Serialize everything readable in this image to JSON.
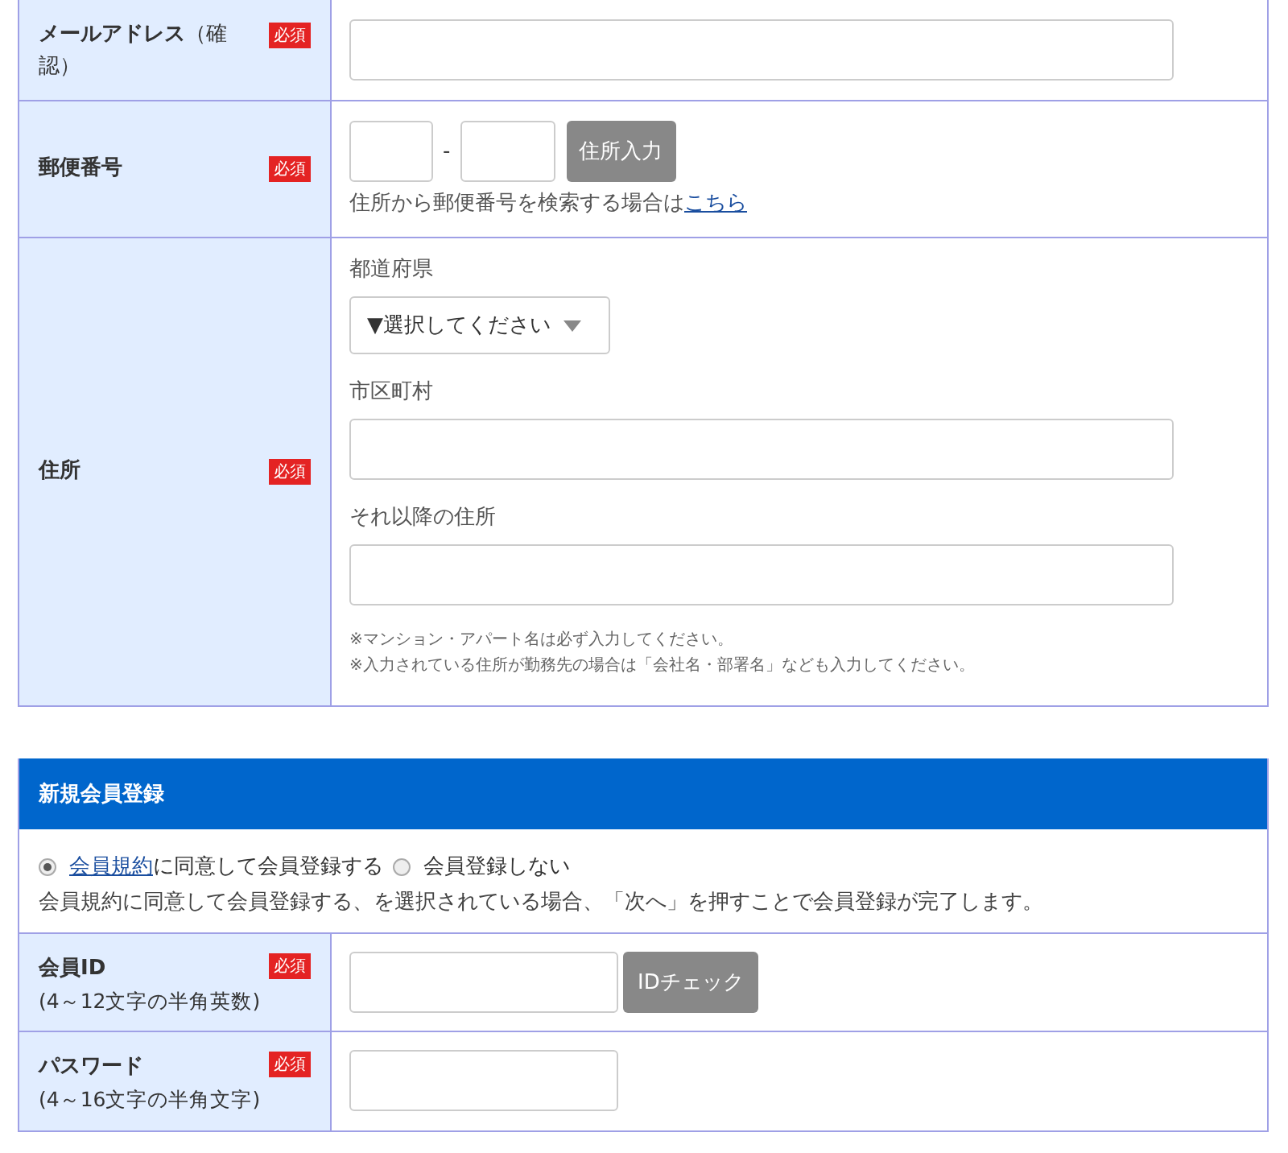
{
  "address_section": {
    "rows": [
      {
        "kind": "email",
        "label": "**メールアドレス**（確認）",
        "required_badge": "必須"
      },
      {
        "kind": "postal",
        "label": "郵便番号",
        "required_badge": "必須",
        "separator": "-",
        "button": "住所入力",
        "hint": "住所から郵便番号を検索する場合は",
        "hint_link": "こちら"
      },
      {
        "kind": "address",
        "label": "住所",
        "required_badge": "必須",
        "prefecture_label": "都道府県",
        "prefecture_select": "▼選択してください",
        "city_label": "市区町村",
        "rest_label": "それ以降の住所",
        "notes": [
          "※マンション・アパート名は必ず入力してください。",
          "※入力されている住所が勤務先の場合は「会社名・部署名」なども入力してください。"
        ]
      }
    ]
  },
  "member_section": {
    "title": "新規会員登録",
    "radios": [
      {
        "link": "会員規約",
        "label": "に同意して会員登録する",
        "selected": true
      },
      {
        "label": "会員登録しない",
        "selected": false
      }
    ],
    "note": "会員規約に同意して会員登録する、を選択されている場合、「次へ」を押すことで会員登録が完了します。",
    "rows": [
      {
        "kind": "member_id",
        "label": "会員ID",
        "sublabel": "(4～12文字の半角英数)",
        "required_badge": "必須",
        "button": "IDチェック"
      },
      {
        "kind": "password",
        "label": "パスワード",
        "sublabel": "(4～16文字の半角文字)",
        "required_badge": "必須"
      }
    ]
  }
}
